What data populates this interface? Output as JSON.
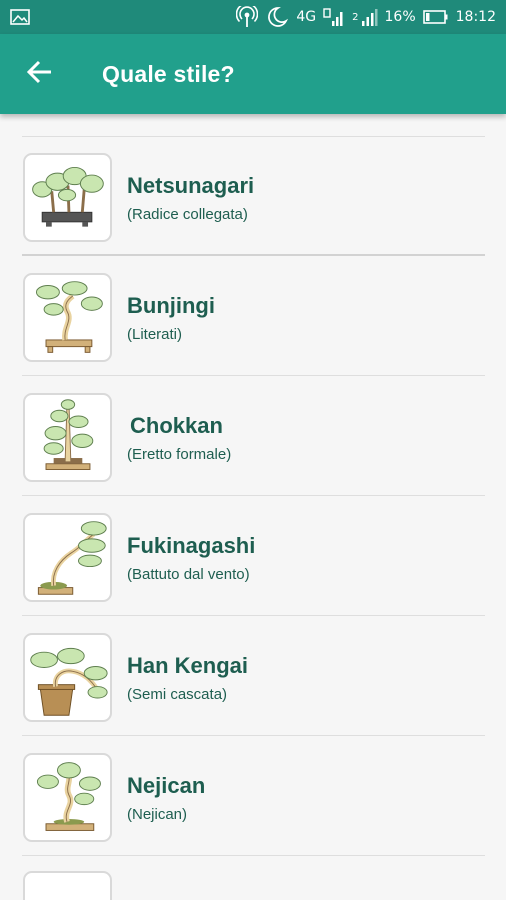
{
  "status_bar": {
    "network": "4G",
    "sim_label": "2",
    "battery": "16%",
    "time": "18:12",
    "icons": [
      "image-icon",
      "hotspot-icon",
      "moon-icon",
      "signal-icon",
      "battery-icon"
    ]
  },
  "app_bar": {
    "title": "Quale stile?",
    "back_icon": "arrow-left-icon",
    "color": "#21a08c",
    "status_color": "#1f8a7a"
  },
  "styles": [
    {
      "name": "Netsunagari",
      "subtitle": "(Radice collegata)",
      "icon": "raft-bonsai-icon"
    },
    {
      "name": "Bunjingi",
      "subtitle": "(Literati)",
      "icon": "literati-bonsai-icon"
    },
    {
      "name": "Chokkan",
      "subtitle": "(Eretto formale)",
      "icon": "formal-upright-bonsai-icon"
    },
    {
      "name": "Fukinagashi",
      "subtitle": "(Battuto dal vento)",
      "icon": "windswept-bonsai-icon"
    },
    {
      "name": "Han Kengai",
      "subtitle": "(Semi cascata)",
      "icon": "semi-cascade-bonsai-icon"
    },
    {
      "name": "Nejican",
      "subtitle": "(Nejican)",
      "icon": "twisted-bonsai-icon"
    }
  ],
  "colors": {
    "text": "#1e5e50",
    "foliage": "#c9e6b0",
    "foliage_outline": "#5f7f4f",
    "trunk": "#e9d3a0",
    "pot": "#d2b17a"
  }
}
